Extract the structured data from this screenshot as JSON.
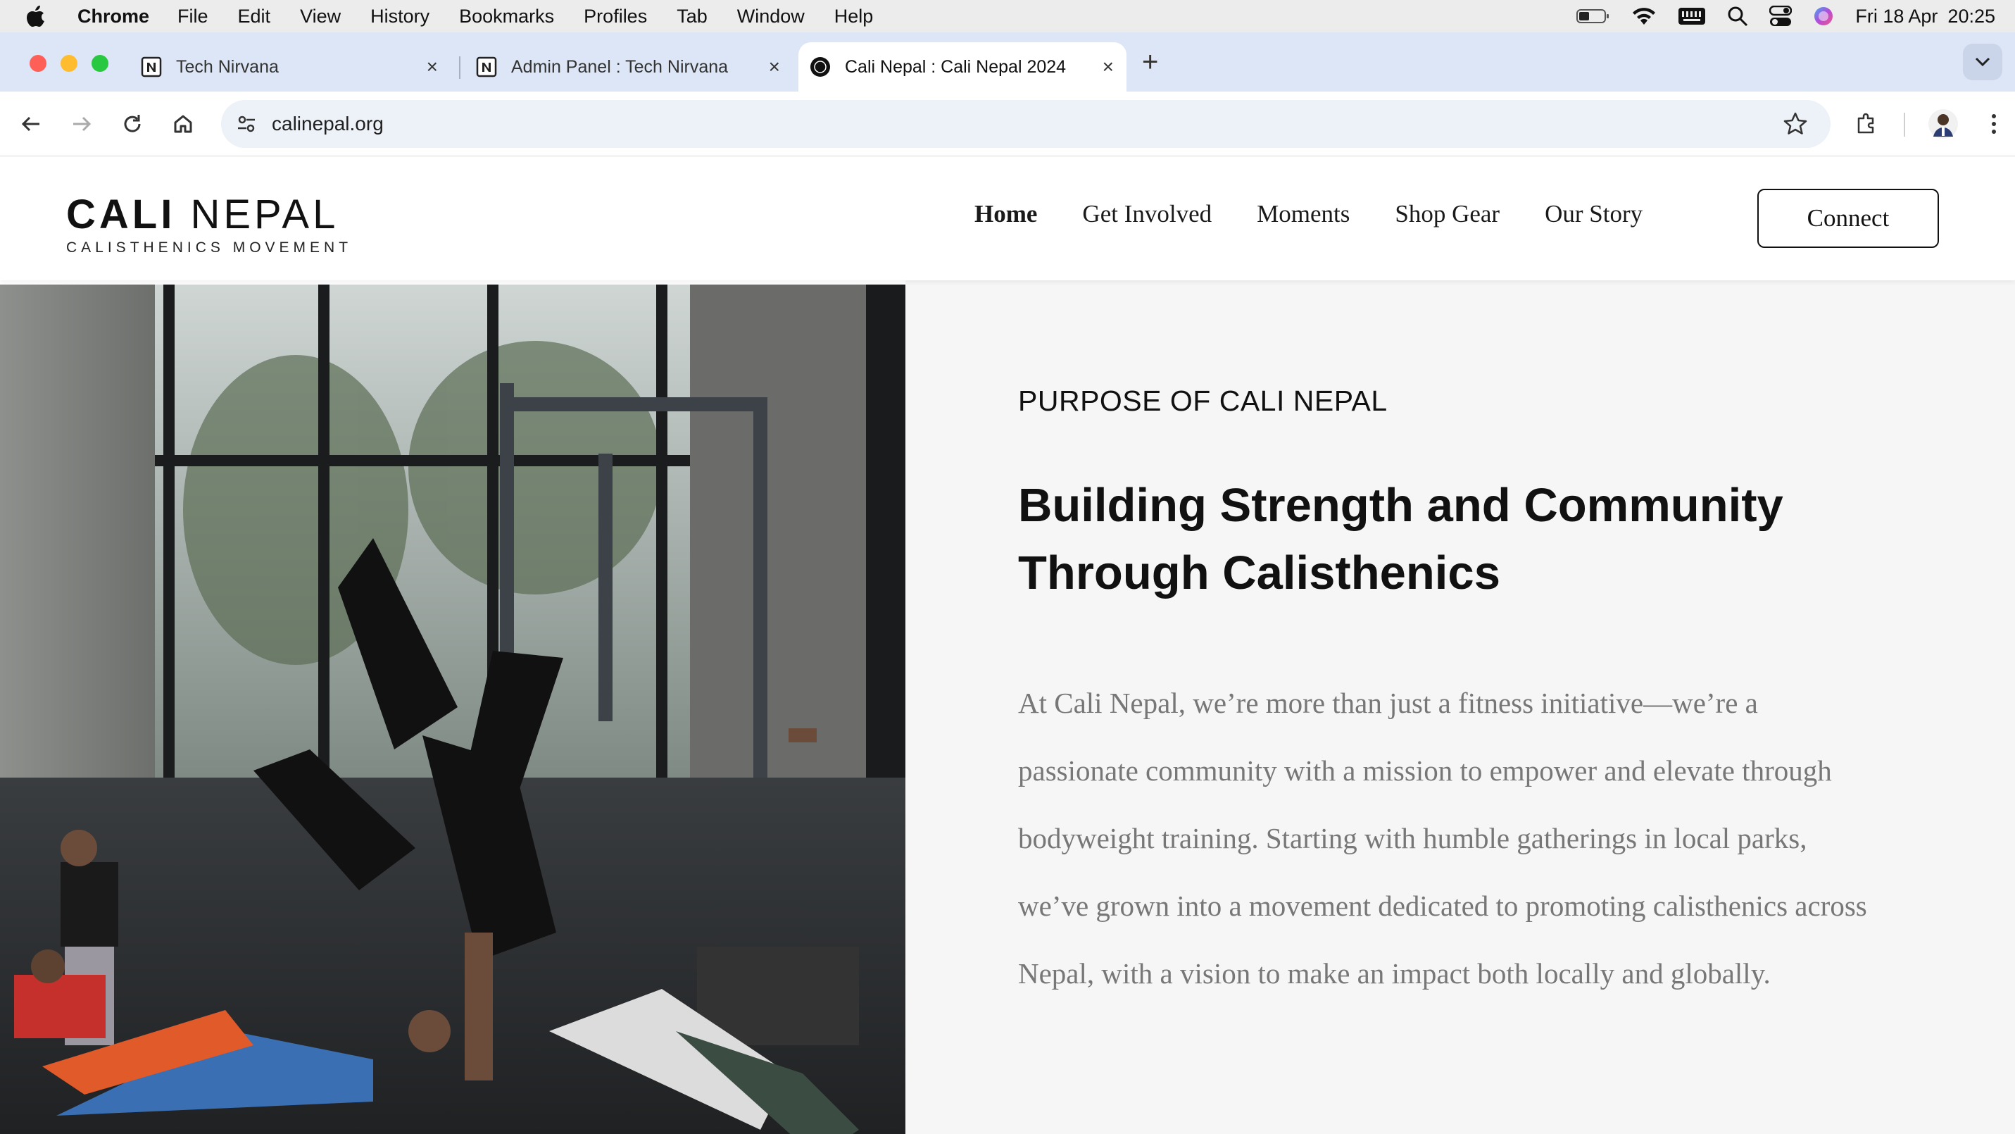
{
  "menubar": {
    "app": "Chrome",
    "menus": [
      "File",
      "Edit",
      "View",
      "History",
      "Bookmarks",
      "Profiles",
      "Tab",
      "Window",
      "Help"
    ],
    "clock": {
      "date": "Fri 18 Apr",
      "time": "20:25"
    }
  },
  "tabs": [
    {
      "title": "Tech Nirvana",
      "favicon": "notion-icon"
    },
    {
      "title": "Admin Panel : Tech Nirvana",
      "favicon": "notion-icon"
    },
    {
      "title": "Cali Nepal : Cali Nepal 2024",
      "favicon": "cali-nepal-icon",
      "active": true
    }
  ],
  "address": {
    "url": "calinepal.org"
  },
  "site": {
    "logo": {
      "bold": "CALI",
      "light": "NEPAL",
      "tagline": "CALISTHENICS MOVEMENT"
    },
    "nav": [
      {
        "label": "Home",
        "active": true
      },
      {
        "label": "Get Involved"
      },
      {
        "label": "Moments"
      },
      {
        "label": "Shop Gear"
      },
      {
        "label": "Our Story"
      }
    ],
    "cta": "Connect"
  },
  "hero": {
    "eyebrow": "PURPOSE OF CALI NEPAL",
    "headline_line1": "Building Strength and Community",
    "headline_line2": "Through Calisthenics",
    "paragraph": "At Cali Nepal, we’re more than just a fitness initiative—we’re a passionate community with a mission to empower and elevate through bodyweight training. Starting with humble gatherings in local parks, we’ve grown into a movement dedicated to promoting calisthenics across Nepal, with a vision to make an impact both locally and globally."
  },
  "colors": {
    "accent": "#111111",
    "tabstrip": "#dde6f6",
    "paragraph": "#777777"
  }
}
